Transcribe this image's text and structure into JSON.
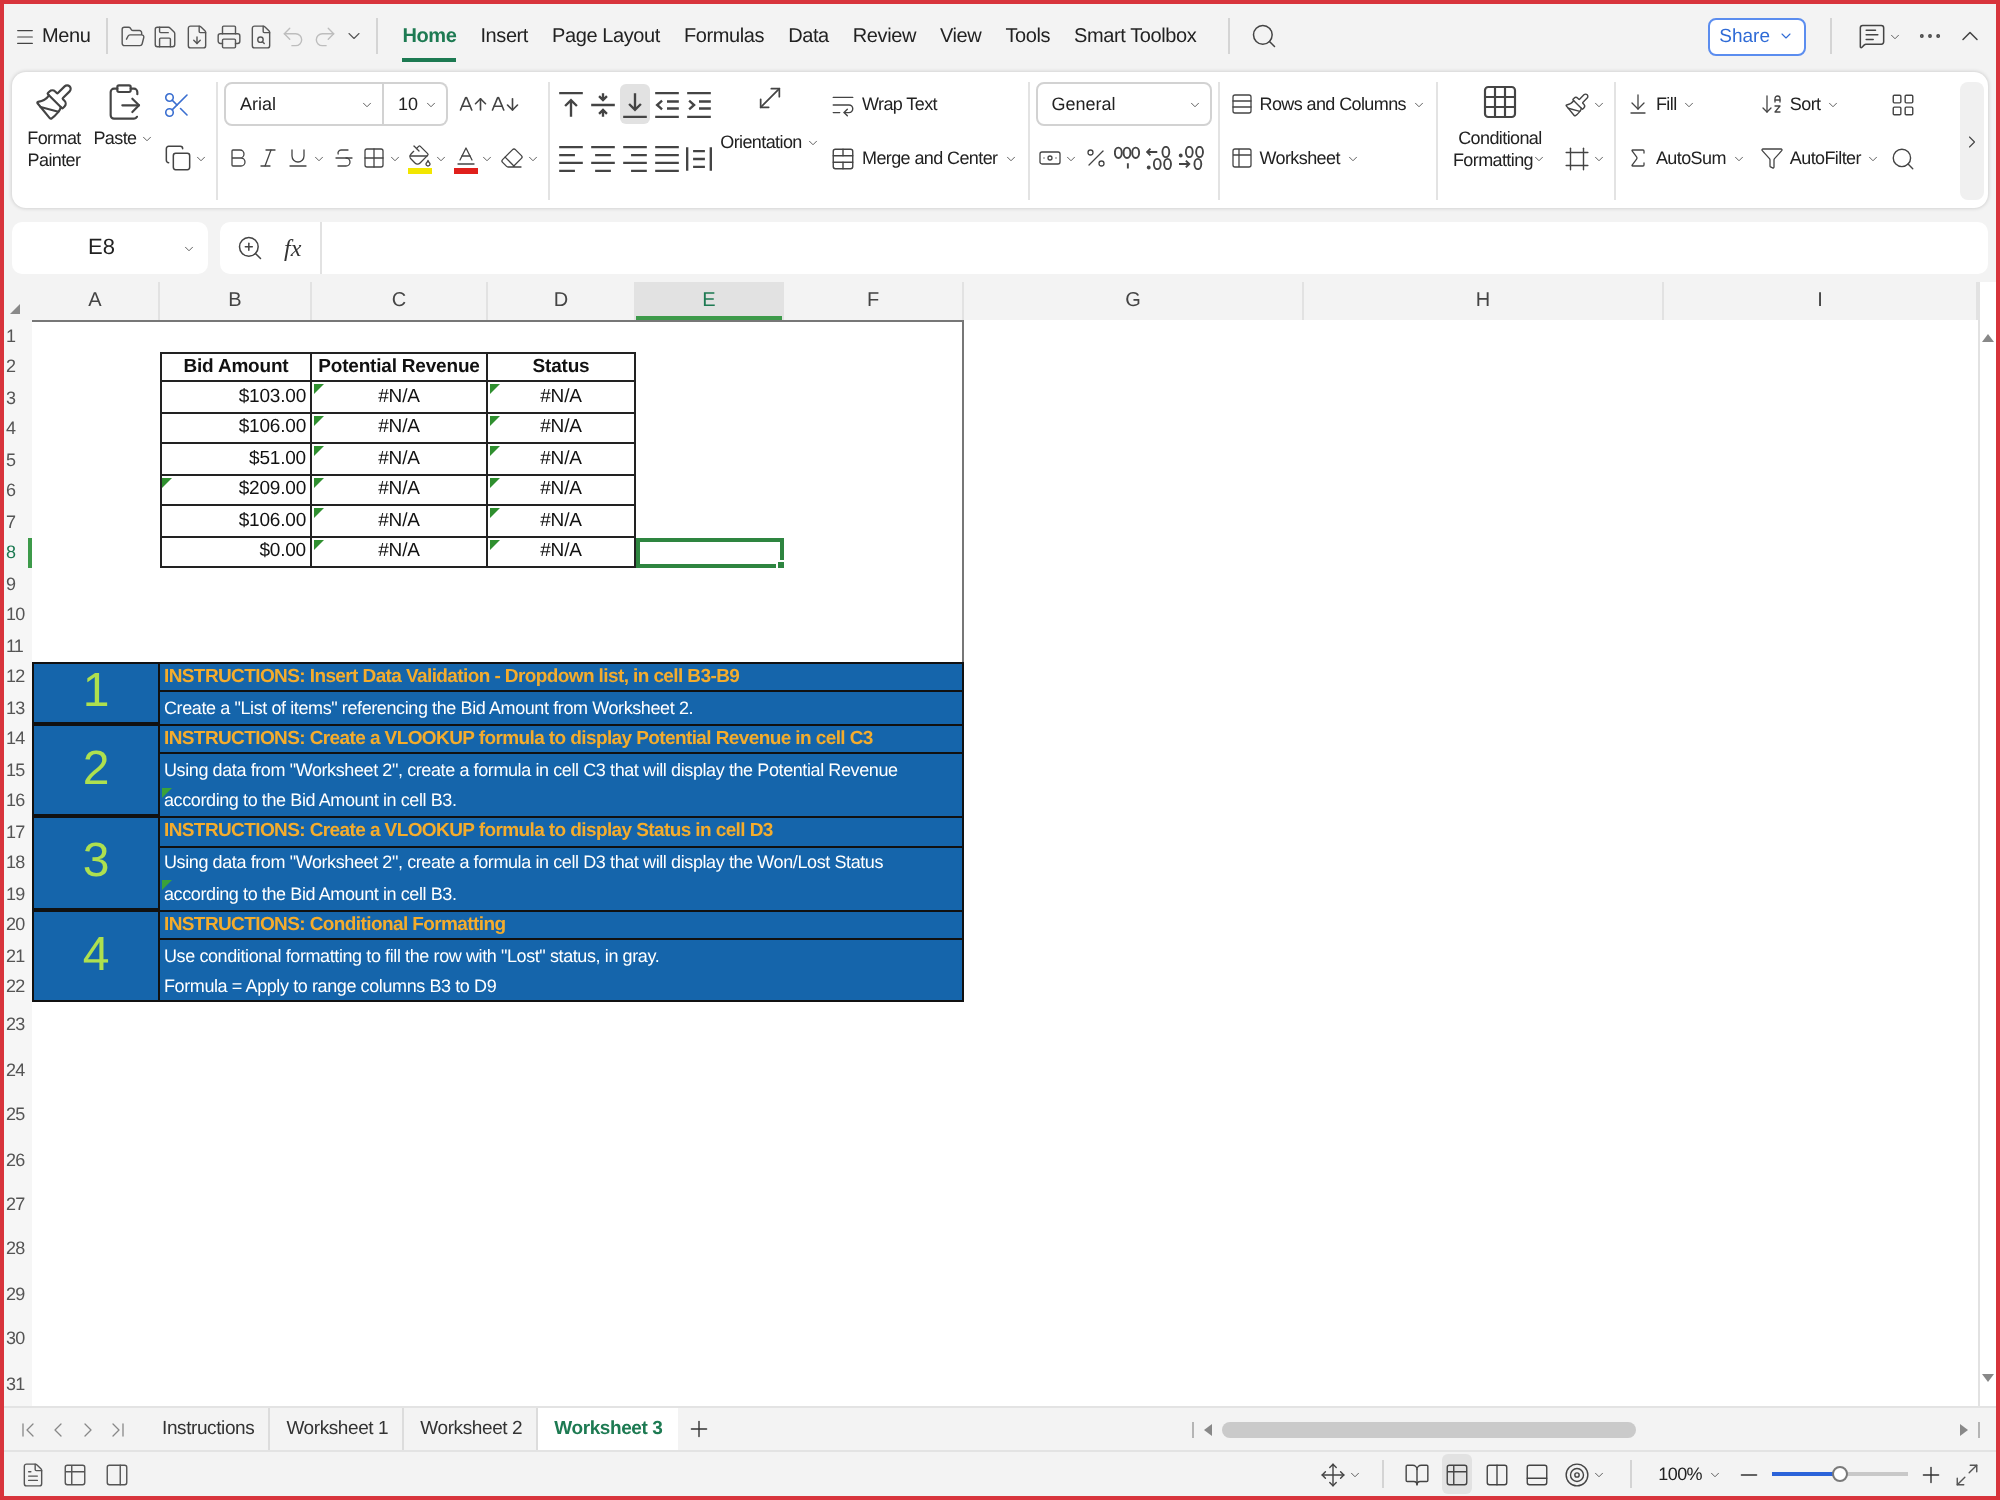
{
  "top_bar": {
    "menu": "Menu",
    "quick_access": [
      {
        "kind": "open",
        "disabled": false
      },
      {
        "kind": "save",
        "disabled": false
      },
      {
        "kind": "export",
        "disabled": false
      },
      {
        "kind": "print",
        "disabled": false
      },
      {
        "kind": "preview",
        "disabled": false
      },
      {
        "kind": "undo",
        "disabled": true
      },
      {
        "kind": "redo",
        "disabled": true
      }
    ],
    "tabs": [
      {
        "label": "Home",
        "selected": true
      },
      {
        "label": "Insert",
        "selected": false
      },
      {
        "label": "Page Layout",
        "selected": false
      },
      {
        "label": "Formulas",
        "selected": false
      },
      {
        "label": "Data",
        "selected": false
      },
      {
        "label": "Review",
        "selected": false
      },
      {
        "label": "View",
        "selected": false
      },
      {
        "label": "Tools",
        "selected": false
      },
      {
        "label": "Smart Toolbox",
        "selected": false
      }
    ],
    "share": "Share"
  },
  "ribbon": {
    "clipboard": {
      "format_painter": "Format Painter",
      "paste": "Paste"
    },
    "font": {
      "name": "Arial",
      "size": "10"
    },
    "alignment": {
      "buttons": [
        {
          "kind": "top",
          "selected": false
        },
        {
          "kind": "middle",
          "selected": false
        },
        {
          "kind": "bottom",
          "selected": true
        },
        {
          "kind": "outdent",
          "selected": false
        },
        {
          "kind": "indent",
          "selected": false
        },
        {
          "kind": "left",
          "selected": false
        },
        {
          "kind": "center",
          "selected": false
        },
        {
          "kind": "right",
          "selected": false
        },
        {
          "kind": "justify",
          "selected": false
        },
        {
          "kind": "distributed",
          "selected": false
        }
      ],
      "orientation": "Orientation",
      "wrap_text": "Wrap Text",
      "merge": "Merge and Center"
    },
    "number": {
      "format": "General"
    },
    "cells": {
      "rows_columns": "Rows and Columns",
      "worksheet": "Worksheet"
    },
    "styles": {
      "conditional_formatting": "Conditional Formatting"
    },
    "editing": {
      "fill": "Fill",
      "sort": "Sort",
      "autosum": "AutoSum",
      "autofilter": "AutoFilter"
    }
  },
  "formula_bar": {
    "cell_ref": "E8",
    "function_label": "fx"
  },
  "sheet": {
    "columns": [
      {
        "label": "A",
        "selected": false
      },
      {
        "label": "B",
        "selected": false
      },
      {
        "label": "C",
        "selected": false
      },
      {
        "label": "D",
        "selected": false
      },
      {
        "label": "E",
        "selected": true
      },
      {
        "label": "F",
        "selected": false
      },
      {
        "label": "G",
        "selected": false
      },
      {
        "label": "H",
        "selected": false
      },
      {
        "label": "I",
        "selected": false
      }
    ],
    "rows": [
      {
        "label": "1",
        "selected": false
      },
      {
        "label": "2",
        "selected": false
      },
      {
        "label": "3",
        "selected": false
      },
      {
        "label": "4",
        "selected": false
      },
      {
        "label": "5",
        "selected": false
      },
      {
        "label": "6",
        "selected": false
      },
      {
        "label": "7",
        "selected": false
      },
      {
        "label": "8",
        "selected": true
      },
      {
        "label": "9",
        "selected": false
      },
      {
        "label": "10",
        "selected": false
      },
      {
        "label": "11",
        "selected": false
      },
      {
        "label": "12",
        "selected": false
      },
      {
        "label": "13",
        "selected": false
      },
      {
        "label": "14",
        "selected": false
      },
      {
        "label": "15",
        "selected": false
      },
      {
        "label": "16",
        "selected": false
      },
      {
        "label": "17",
        "selected": false
      },
      {
        "label": "18",
        "selected": false
      },
      {
        "label": "19",
        "selected": false
      },
      {
        "label": "20",
        "selected": false
      },
      {
        "label": "21",
        "selected": false
      },
      {
        "label": "22",
        "selected": false
      },
      {
        "label": "23",
        "selected": false
      },
      {
        "label": "24",
        "selected": false
      },
      {
        "label": "25",
        "selected": false
      },
      {
        "label": "26",
        "selected": false
      },
      {
        "label": "27",
        "selected": false
      },
      {
        "label": "28",
        "selected": false
      },
      {
        "label": "29",
        "selected": false
      },
      {
        "label": "30",
        "selected": false
      },
      {
        "label": "31",
        "selected": false
      }
    ]
  },
  "bid_table": {
    "columns": [
      "Bid Amount",
      "Potential Revenue",
      "Status"
    ],
    "rows": [
      [
        {
          "text": "$103.00",
          "error_flag": false
        },
        {
          "text": "#N/A",
          "error_flag": true
        },
        {
          "text": "#N/A",
          "error_flag": true
        }
      ],
      [
        {
          "text": "$106.00",
          "error_flag": false
        },
        {
          "text": "#N/A",
          "error_flag": true
        },
        {
          "text": "#N/A",
          "error_flag": true
        }
      ],
      [
        {
          "text": "$51.00",
          "error_flag": false
        },
        {
          "text": "#N/A",
          "error_flag": true
        },
        {
          "text": "#N/A",
          "error_flag": true
        }
      ],
      [
        {
          "text": "$209.00",
          "error_flag": true
        },
        {
          "text": "#N/A",
          "error_flag": true
        },
        {
          "text": "#N/A",
          "error_flag": true
        }
      ],
      [
        {
          "text": "$106.00",
          "error_flag": false
        },
        {
          "text": "#N/A",
          "error_flag": true
        },
        {
          "text": "#N/A",
          "error_flag": true
        }
      ],
      [
        {
          "text": "$0.00",
          "error_flag": false
        },
        {
          "text": "#N/A",
          "error_flag": true
        },
        {
          "text": "#N/A",
          "error_flag": true
        }
      ]
    ]
  },
  "instructions": [
    {
      "number": "1",
      "heading": "INSTRUCTIONS: Insert Data Validation - Dropdown list, in cell B3-B9",
      "lines": [
        {
          "text": "Create a \"List of items\" referencing the Bid Amount from Worksheet 2.",
          "error_flag": false
        }
      ]
    },
    {
      "number": "2",
      "heading": "INSTRUCTIONS: Create a VLOOKUP formula to display Potential Revenue in cell C3",
      "lines": [
        {
          "text": "Using data from \"Worksheet 2\", create a formula in cell C3 that will display the Potential Revenue",
          "error_flag": false
        },
        {
          "text": "according to the Bid Amount in cell B3.",
          "error_flag": true
        }
      ]
    },
    {
      "number": "3",
      "heading": "INSTRUCTIONS: Create a VLOOKUP formula to display Status in cell D3",
      "lines": [
        {
          "text": "Using data from \"Worksheet 2\", create a formula in cell D3 that will display the Won/Lost Status",
          "error_flag": false
        },
        {
          "text": "according to the Bid Amount in cell B3.",
          "error_flag": true
        }
      ]
    },
    {
      "number": "4",
      "heading": "INSTRUCTIONS: Conditional Formatting",
      "lines": [
        {
          "text": "Use conditional formatting to fill the row with \"Lost\" status, in gray.",
          "error_flag": false
        },
        {
          "text": "Formula = Apply to range columns B3 to D9",
          "error_flag": false
        }
      ]
    }
  ],
  "sheet_tabs": [
    {
      "label": "Instructions",
      "selected": false
    },
    {
      "label": "Worksheet 1",
      "selected": false
    },
    {
      "label": "Worksheet 2",
      "selected": false
    },
    {
      "label": "Worksheet 3",
      "selected": true
    }
  ],
  "status_bar": {
    "views": [
      {
        "kind": "reading",
        "selected": false
      },
      {
        "kind": "normal",
        "selected": true
      },
      {
        "kind": "page_break",
        "selected": false
      },
      {
        "kind": "page_layout",
        "selected": false
      }
    ],
    "zoom": "100%",
    "zoom_slider": {
      "level": 0.5
    }
  }
}
